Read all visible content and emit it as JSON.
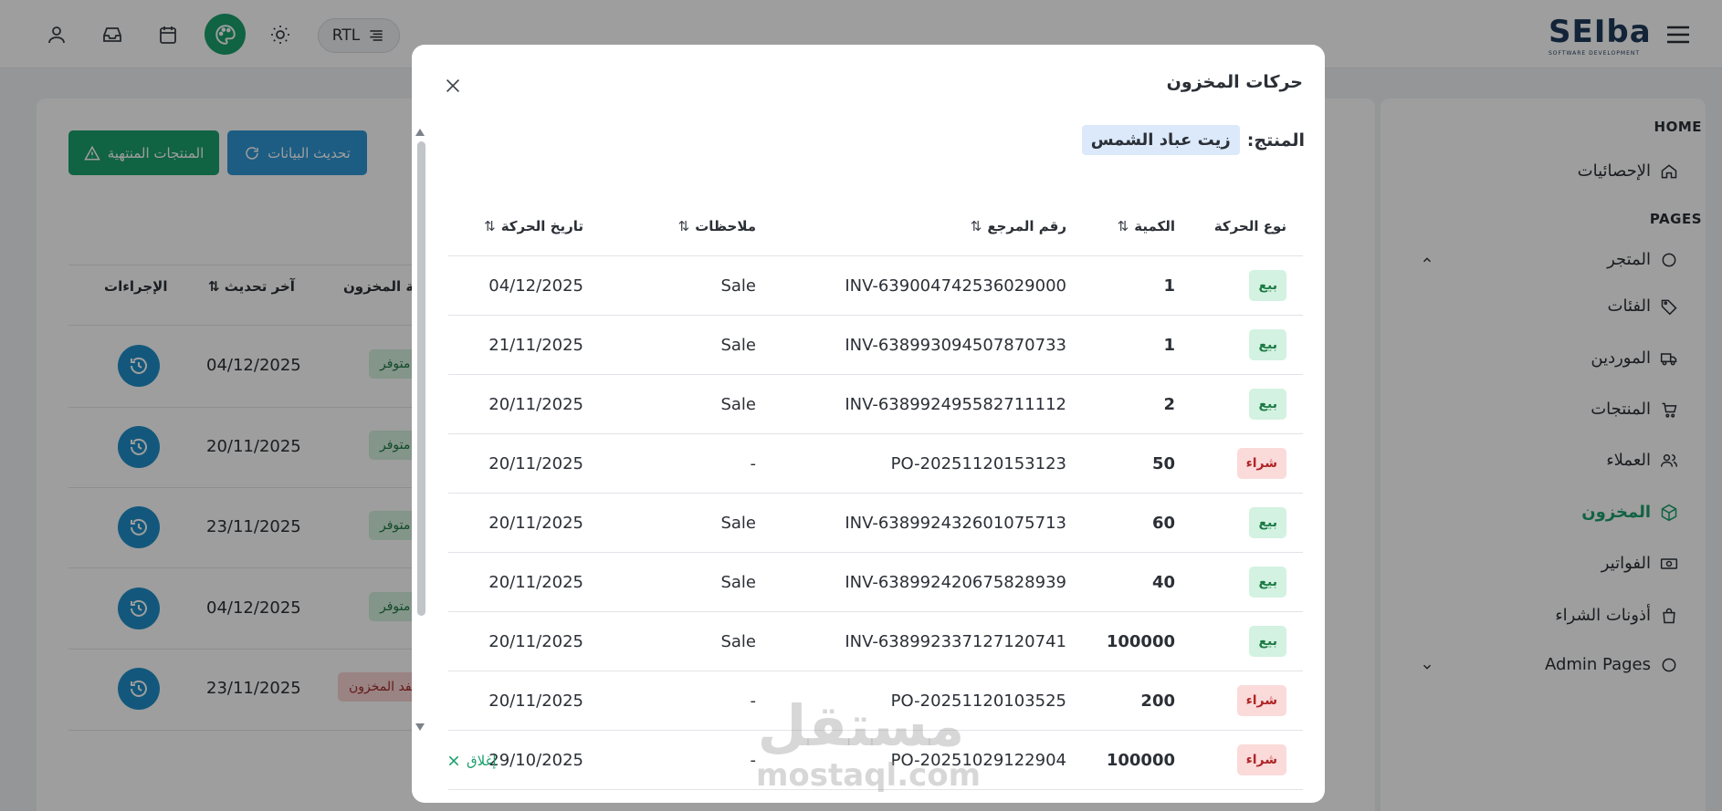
{
  "topbar": {
    "rtl_label": "RTL",
    "logo_text": "SEIba",
    "logo_sub": "SOFTWARE DEVELOPMENT"
  },
  "toolbar": {
    "expired_products_label": "المنتجات المنتهية",
    "refresh_label": "تحديث البيانات"
  },
  "background_table": {
    "headers": {
      "actions": "الإجراءات",
      "last_update": "آخر تحديث",
      "stock_status": "حالة المخزون"
    },
    "rows": [
      {
        "date": "04/12/2025",
        "status": "متوفر",
        "status_type": "ok"
      },
      {
        "date": "20/11/2025",
        "status": "متوفر",
        "status_type": "ok"
      },
      {
        "date": "23/11/2025",
        "status": "متوفر",
        "status_type": "ok"
      },
      {
        "date": "04/12/2025",
        "status": "متوفر",
        "status_type": "ok"
      },
      {
        "date": "23/11/2025",
        "status": "نفد المخزون",
        "status_type": "out"
      }
    ]
  },
  "sidebar": {
    "home_section": "HOME",
    "pages_section": "PAGES",
    "items": [
      {
        "label": "الإحصائيات",
        "icon": "home-icon"
      },
      {
        "label": "المتجر",
        "icon": "circle-icon"
      },
      {
        "label": "الفئات",
        "icon": "tag-icon"
      },
      {
        "label": "الموردين",
        "icon": "truck-icon"
      },
      {
        "label": "المنتجات",
        "icon": "cart-icon"
      },
      {
        "label": "العملاء",
        "icon": "users-icon"
      },
      {
        "label": "المخزون",
        "icon": "box-icon",
        "active": true
      },
      {
        "label": "الفواتير",
        "icon": "cash-icon"
      },
      {
        "label": "أذونات الشراء",
        "icon": "bag-icon"
      },
      {
        "label": "Admin Pages",
        "icon": "circle-icon"
      }
    ]
  },
  "modal": {
    "title": "حركات المخزون",
    "product_label": "المنتج:",
    "product_name": "زيت عباد الشمس",
    "close_label": "إغلاق",
    "columns": {
      "type": "نوع الحركة",
      "quantity": "الكمية",
      "reference": "رقم المرجع",
      "notes": "ملاحظات",
      "date": "تاريخ الحركة"
    },
    "rows": [
      {
        "type": "بيع",
        "kind": "sell",
        "quantity": "1",
        "reference": "INV-639004742536029000",
        "notes": "Sale",
        "date": "04/12/2025"
      },
      {
        "type": "بيع",
        "kind": "sell",
        "quantity": "1",
        "reference": "INV-638993094507870733",
        "notes": "Sale",
        "date": "21/11/2025"
      },
      {
        "type": "بيع",
        "kind": "sell",
        "quantity": "2",
        "reference": "INV-638992495582711112",
        "notes": "Sale",
        "date": "20/11/2025"
      },
      {
        "type": "شراء",
        "kind": "buy",
        "quantity": "50",
        "reference": "PO-20251120153123",
        "notes": "-",
        "date": "20/11/2025"
      },
      {
        "type": "بيع",
        "kind": "sell",
        "quantity": "60",
        "reference": "INV-638992432601075713",
        "notes": "Sale",
        "date": "20/11/2025"
      },
      {
        "type": "بيع",
        "kind": "sell",
        "quantity": "40",
        "reference": "INV-638992420675828939",
        "notes": "Sale",
        "date": "20/11/2025"
      },
      {
        "type": "بيع",
        "kind": "sell",
        "quantity": "100000",
        "reference": "INV-638992337127120741",
        "notes": "Sale",
        "date": "20/11/2025"
      },
      {
        "type": "شراء",
        "kind": "buy",
        "quantity": "200",
        "reference": "PO-20251120103525",
        "notes": "-",
        "date": "20/11/2025"
      },
      {
        "type": "شراء",
        "kind": "buy",
        "quantity": "100000",
        "reference": "PO-20251029122904",
        "notes": "-",
        "date": "29/10/2025"
      }
    ]
  },
  "watermark": {
    "arabic": "مستقل",
    "latin": "mostaql.com"
  },
  "colors": {
    "primary_green": "#1aa06d",
    "refresh_blue": "#2f97d4",
    "action_blue": "#1f8ec9",
    "sell_bg": "#d3f2e1",
    "buy_bg": "#fbdada"
  }
}
